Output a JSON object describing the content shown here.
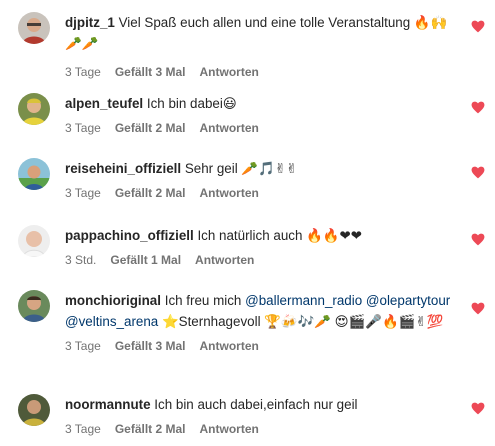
{
  "accent": {
    "heart": "#ed4956",
    "mention": "#00376b",
    "meta": "#737373"
  },
  "comments": [
    {
      "username": "djpitz_1",
      "text": "Viel Spaß euch allen und eine tolle Veranstaltung 🔥🙌 🥕🥕",
      "time": "3 Tage",
      "likes": "Gefällt 3 Mal",
      "reply": "Antworten",
      "liked": true,
      "avatar": "avatar-djpitz"
    },
    {
      "username": "alpen_teufel",
      "text": "Ich bin dabei😃",
      "time": "3 Tage",
      "likes": "Gefällt 2 Mal",
      "reply": "Antworten",
      "liked": true,
      "avatar": "avatar-alpen"
    },
    {
      "username": "reiseheini_offiziell",
      "text": "Sehr geil 🥕🎵✌✌",
      "time": "3 Tage",
      "likes": "Gefällt 2 Mal",
      "reply": "Antworten",
      "liked": true,
      "avatar": "avatar-reiseheini"
    },
    {
      "username": "pappachino_offiziell",
      "text": "Ich natürlich auch 🔥🔥❤❤",
      "time": "3 Std.",
      "likes": "Gefällt 1 Mal",
      "reply": "Antworten",
      "liked": true,
      "avatar": "avatar-pappachino"
    },
    {
      "username": "monchioriginal",
      "text_before": "Ich freu mich",
      "mention1": "@ballermann_radio",
      "mention2": "@olepartytour",
      "mention3": "@veltins_arena",
      "text_after": "⭐Sternhagevoll 🏆🍻🎶🥕 😍🎬🎤🔥🎬✌💯",
      "time": "3 Tage",
      "likes": "Gefällt 3 Mal",
      "reply": "Antworten",
      "liked": true,
      "avatar": "avatar-monchi"
    },
    {
      "username": "noormannute",
      "text": "Ich bin auch dabei,einfach nur geil",
      "time": "3 Tage",
      "likes": "Gefällt 2 Mal",
      "reply": "Antworten",
      "liked": true,
      "avatar": "avatar-noormann"
    }
  ]
}
